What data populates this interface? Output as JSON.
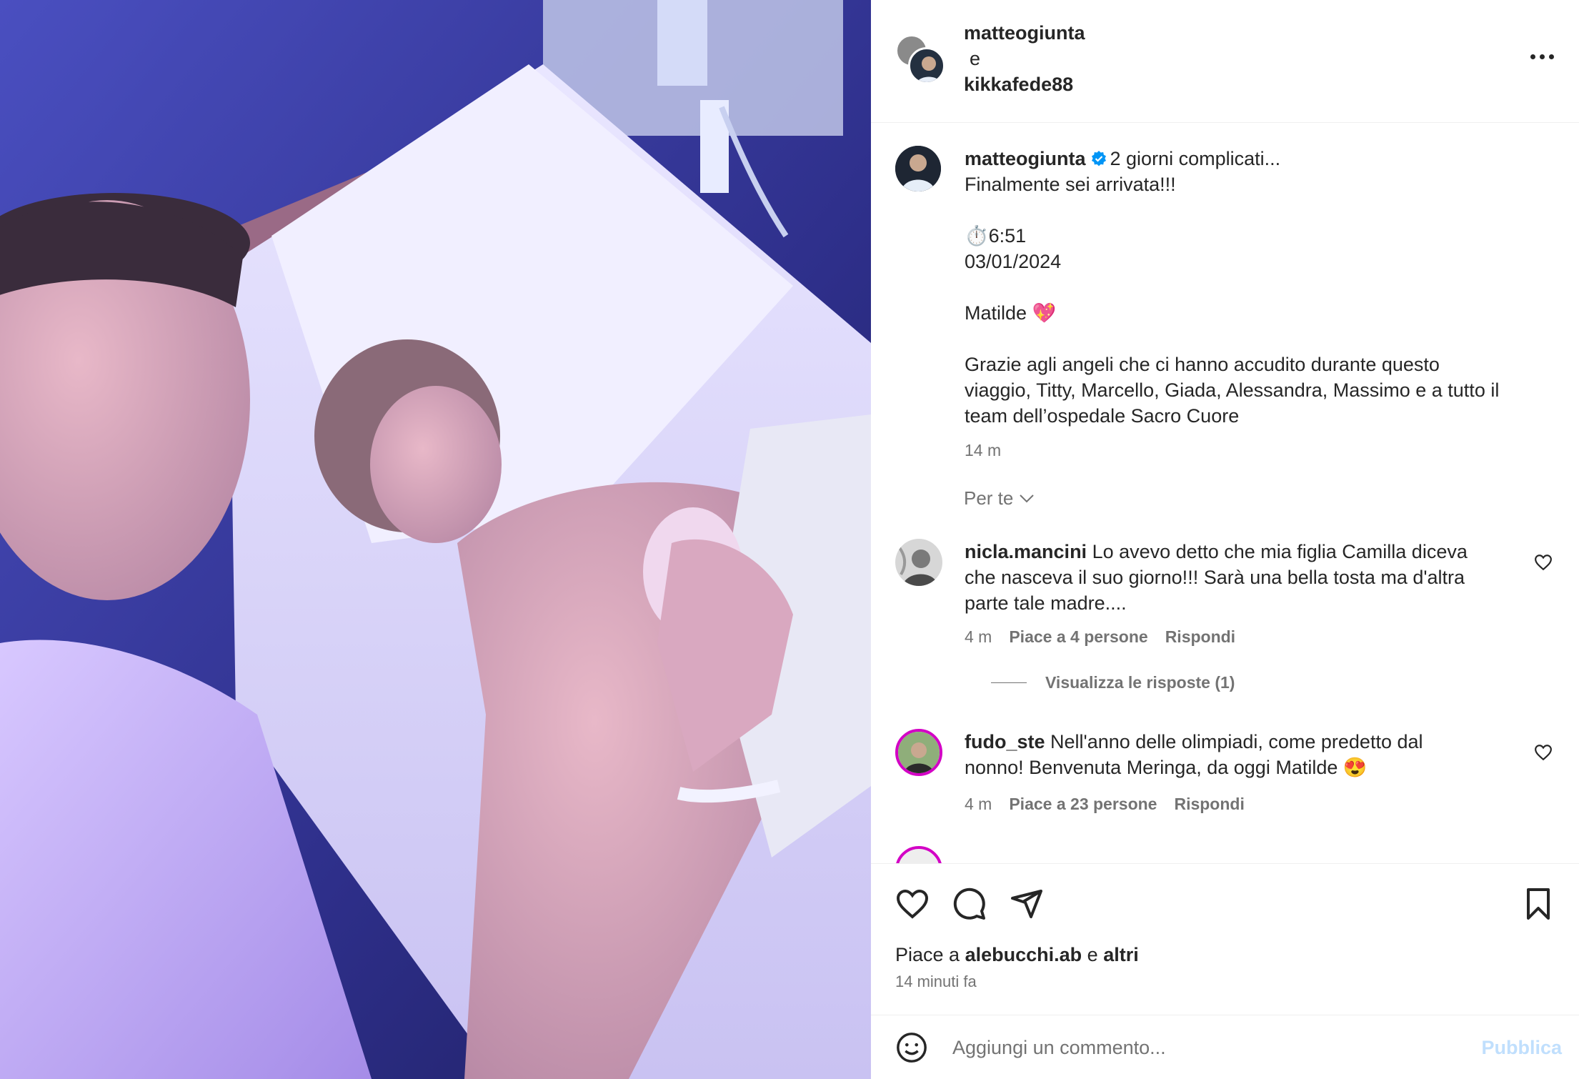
{
  "header": {
    "user1": "matteogiunta",
    "conjunction": "e",
    "user2": "kikkafede88"
  },
  "caption": {
    "username": "matteogiunta",
    "lines": [
      "2 giorni complicati...",
      "Finalmente sei arrivata!!!",
      "",
      "⏱️6:51",
      "03/01/2024",
      "",
      "Matilde 💖",
      "",
      "Grazie agli angeli che ci hanno accudito durante questo",
      "viaggio, Titty, Marcello, Giada, Alessandra, Massimo e a tutto il",
      "team dell’ospedale Sacro Cuore"
    ],
    "time": "14 m"
  },
  "filter_label": "Per te",
  "comments": [
    {
      "username": "nicla.mancini",
      "text_lines": [
        "Lo avevo detto che mia figlia Camilla diceva",
        "che nasceva il suo giorno!!! Sarà una bella tosta ma d'altra",
        "parte tale madre...."
      ],
      "time": "4 m",
      "likes": "Piace a 4 persone",
      "reply": "Rispondi",
      "view_replies": "Visualizza le risposte (1)"
    },
    {
      "username": "fudo_ste",
      "text_lines": [
        "Nell'anno delle olimpiadi, come predetto dal",
        "nonno! Benvenuta Meringa, da oggi Matilde 😍"
      ],
      "time": "4 m",
      "likes": "Piace a 23 persone",
      "reply": "Rispondi"
    }
  ],
  "actions": {
    "liked_prefix": "Piace a",
    "liked_user": "alebucchi.ab",
    "liked_mid": "e",
    "liked_others": "altri",
    "post_time": "14 minuti fa"
  },
  "add_comment": {
    "placeholder": "Aggiungi un commento...",
    "publish": "Pubblica"
  },
  "colors": {
    "verified": "#0095f6",
    "story_ring": "#d300c5",
    "publish_disabled": "#c0dffd"
  },
  "icons": [
    "more-options-icon",
    "verified-badge-icon",
    "chevron-down-icon",
    "heart-icon",
    "comment-icon",
    "share-icon",
    "bookmark-icon",
    "emoji-icon"
  ]
}
